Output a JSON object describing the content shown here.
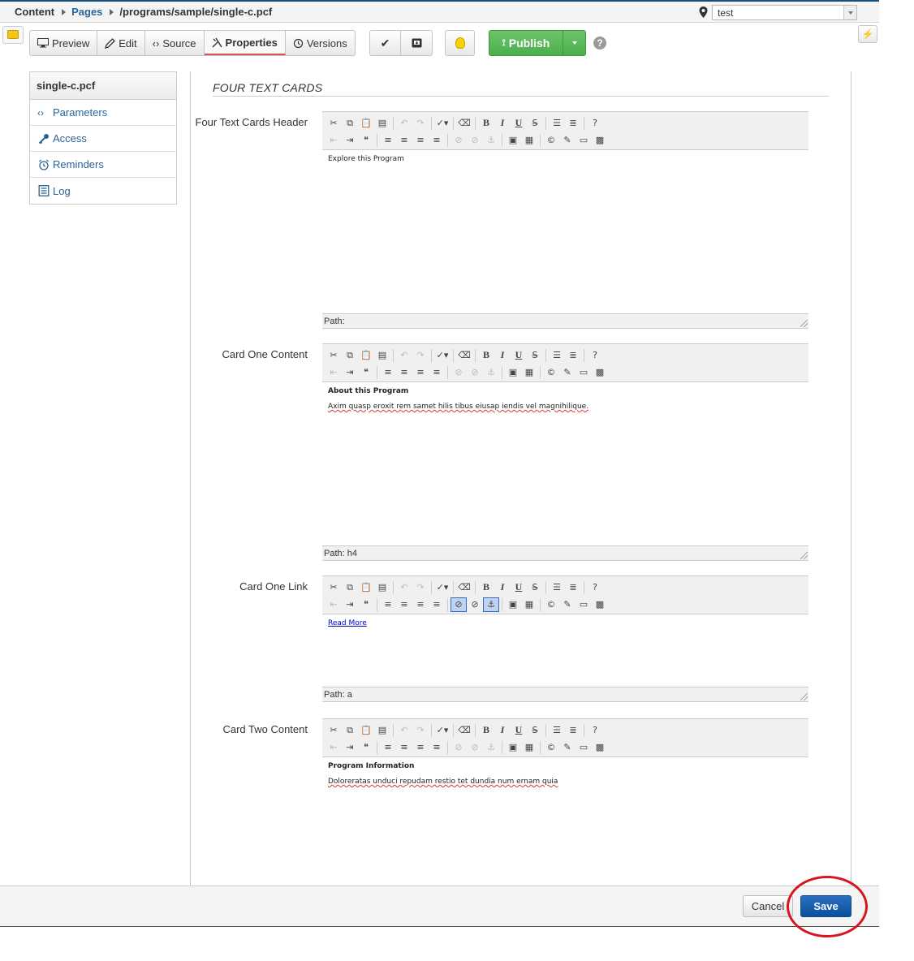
{
  "breadcrumb": {
    "root": "Content",
    "section": "Pages",
    "path": "/programs/sample/single-c.pcf"
  },
  "site_selector": {
    "value": "test"
  },
  "toolbar": {
    "tabs": [
      {
        "label": "Preview",
        "icon": "monitor-icon"
      },
      {
        "label": "Edit",
        "icon": "pencil-icon"
      },
      {
        "label": "Source",
        "icon": "code-icon"
      },
      {
        "label": "Properties",
        "icon": "tools-icon"
      },
      {
        "label": "Versions",
        "icon": "history-icon"
      }
    ],
    "publish_label": "Publish"
  },
  "sidebar": {
    "title": "single-c.pcf",
    "items": [
      {
        "label": "Parameters",
        "icon": "code-icon"
      },
      {
        "label": "Access",
        "icon": "key-icon"
      },
      {
        "label": "Reminders",
        "icon": "alarm-clock-icon"
      },
      {
        "label": "Log",
        "icon": "log-icon"
      }
    ]
  },
  "main": {
    "section_title": "FOUR TEXT CARDS",
    "fields": [
      {
        "label": "Four Text Cards Header",
        "heading": "",
        "content": "Explore this Program",
        "path": "Path:"
      },
      {
        "label": "Card One Content",
        "heading": "About this Program",
        "content": "Axim quasp eroxit rem samet hilis tibus eiusap iendis vel magnihilique.",
        "path": "Path: h4"
      },
      {
        "label": "Card One Link",
        "link": "Read More",
        "path": "Path: a"
      },
      {
        "label": "Card Two Content",
        "heading": "Program Information",
        "content": "Doloreratas unduci repudam restio tet dundia num ernam quia"
      }
    ]
  },
  "footer": {
    "cancel_label": "Cancel",
    "save_label": "Save"
  },
  "colors": {
    "publish_green": "#5cb85c",
    "save_blue": "#0a4f9c",
    "link_blue": "#2a6496",
    "annotation_red": "#d6161f"
  }
}
